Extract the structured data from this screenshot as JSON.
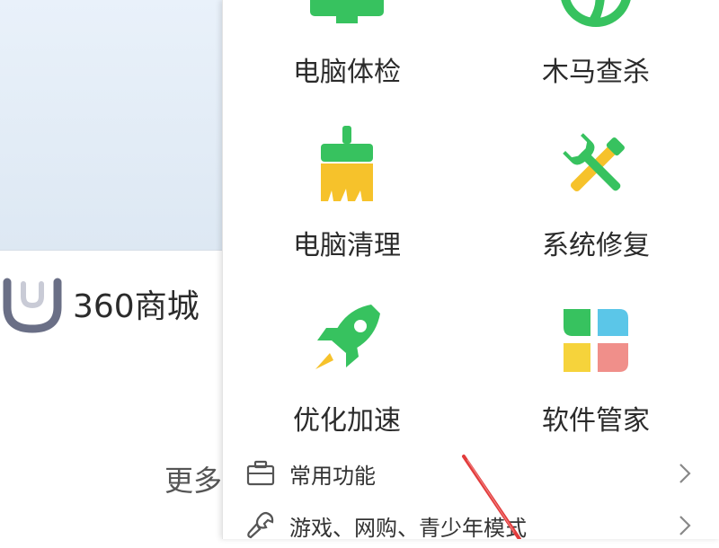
{
  "left": {
    "mall_label": "360商城",
    "more_label": "更多"
  },
  "tools": [
    {
      "label": "电脑体检",
      "icon": "monitor-icon"
    },
    {
      "label": "木马查杀",
      "icon": "trojan-scan-icon"
    },
    {
      "label": "电脑清理",
      "icon": "brush-icon"
    },
    {
      "label": "系统修复",
      "icon": "repair-tools-icon"
    },
    {
      "label": "优化加速",
      "icon": "rocket-icon"
    },
    {
      "label": "软件管家",
      "icon": "software-manager-icon"
    }
  ],
  "menu": [
    {
      "label": "常用功能",
      "icon": "toolbox-icon"
    },
    {
      "label": "游戏、网购、青少年模式",
      "icon": "wrench-icon"
    }
  ],
  "colors": {
    "green": "#37c25f",
    "yellow": "#f6c22b",
    "arrow": "#e23b3b"
  }
}
